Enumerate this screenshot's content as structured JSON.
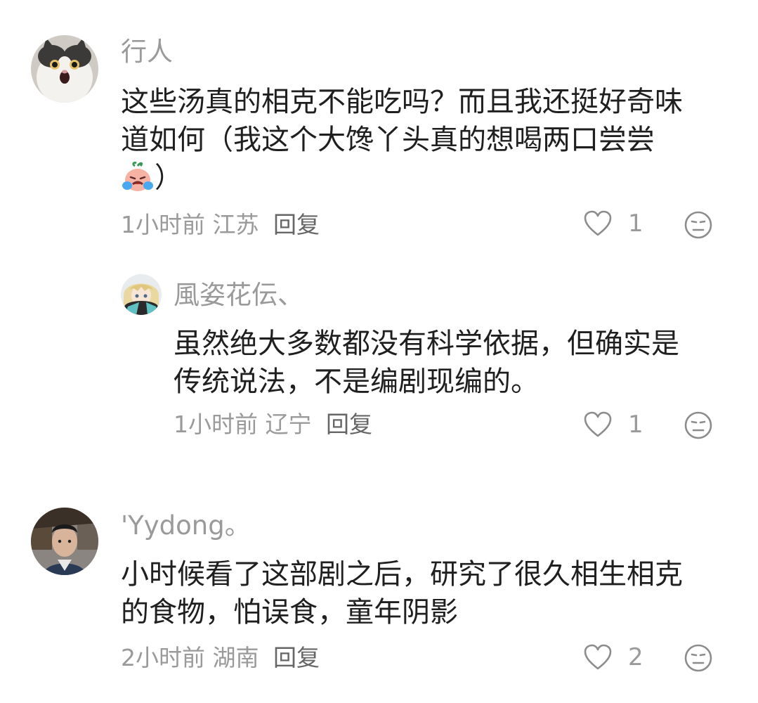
{
  "comments": [
    {
      "username": "行人",
      "text_line1": "这些汤真的相克不能吃吗？而且我还挺好奇味",
      "text_line2": "道如何（我这个大馋丫头真的想喝两口尝尝",
      "text_line3_suffix": "）",
      "time": "1小时前",
      "location": "江苏",
      "reply_label": "回复",
      "likes": "1",
      "avatar_icon": "cat-avatar"
    },
    {
      "username": "風姿花伝、",
      "text_line1": "虽然绝大多数都没有科学依据，但确实是",
      "text_line2": "传统说法，不是编剧现编的。",
      "time": "1小时前",
      "location": "辽宁",
      "reply_label": "回复",
      "likes": "1",
      "avatar_icon": "anime-avatar"
    },
    {
      "username": "'Yydong。",
      "text_line1": "小时候看了这部剧之后，研究了很久相生相克",
      "text_line2": "的食物，怕误食，童年阴影",
      "time": "2小时前",
      "location": "湖南",
      "reply_label": "回复",
      "likes": "2",
      "avatar_icon": "person-avatar"
    }
  ],
  "colors": {
    "secondary_text": "#9a9a9a",
    "primary_text": "#1f1f1f",
    "icon_stroke": "#8c8c8c"
  }
}
